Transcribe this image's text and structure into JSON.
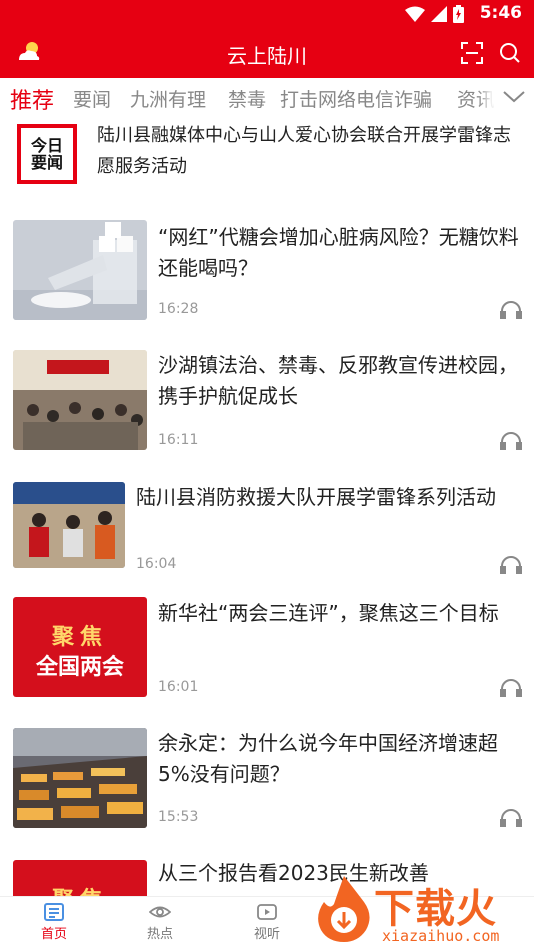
{
  "status_bar": {
    "time": "5:46"
  },
  "app_bar": {
    "title": "云上陆川",
    "icons": [
      "weather-icon",
      "scan-icon",
      "search-icon"
    ]
  },
  "tabs": [
    {
      "label": "推荐",
      "active": true
    },
    {
      "label": "要闻"
    },
    {
      "label": "九洲有理"
    },
    {
      "label": "禁毒"
    },
    {
      "label": "打击网络电信诈骗"
    },
    {
      "label": "资讯"
    }
  ],
  "headline": {
    "logo_text": "今日要闻",
    "title": "陆川县融媒体中心与山人爱心协会联合开展学雷锋志愿服务活动"
  },
  "news": [
    {
      "title": "“网红”代糖会增加心脏病风险？无糖饮料还能喝吗？",
      "time": "16:28"
    },
    {
      "title": "沙湖镇法治、禁毒、反邪教宣传进校园，携手护航促成长",
      "time": "16:11"
    },
    {
      "title": "陆川县消防救援大队开展学雷锋系列活动",
      "time": "16:04"
    },
    {
      "title": "新华社“两会三连评”，聚焦这三个目标",
      "time": "16:01",
      "thumb_text": [
        "聚焦",
        "全国两会"
      ]
    },
    {
      "title": "余永定：为什么说今年中国经济增速超5%没有问题？",
      "time": "15:53"
    },
    {
      "title": "从三个报告看2023民生新改善",
      "time": "",
      "thumb_text": [
        "聚焦",
        ""
      ]
    }
  ],
  "bottom_nav": [
    {
      "label": "首页",
      "active": true
    },
    {
      "label": "热点"
    },
    {
      "label": "视听"
    }
  ],
  "watermark": {
    "text": "下载火",
    "url": "xiazaihuo.com"
  },
  "colors": {
    "brand": "#e60012",
    "watermark": "#f26522"
  }
}
